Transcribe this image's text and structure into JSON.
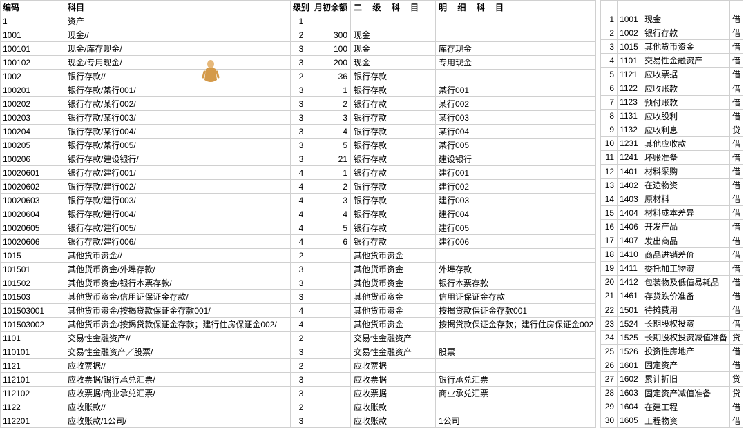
{
  "left": {
    "headers": {
      "code": "编码",
      "subject": "科目",
      "level": "级别",
      "balance": "月初余额",
      "level2": "二 级 科 目",
      "detail": "明   细   科   目"
    },
    "rows": [
      {
        "code": "1",
        "subject": "资产",
        "level": "1",
        "balance": "",
        "l2": "",
        "detail": ""
      },
      {
        "code": "1001",
        "subject": "现金//",
        "level": "2",
        "balance": "300",
        "l2": "现金",
        "detail": ""
      },
      {
        "code": "100101",
        "subject": "现金/库存现金/",
        "level": "3",
        "balance": "100",
        "l2": "现金",
        "detail": "库存现金"
      },
      {
        "code": "100102",
        "subject": "现金/专用现金/",
        "level": "3",
        "balance": "200",
        "l2": "现金",
        "detail": "专用现金"
      },
      {
        "code": "1002",
        "subject": "银行存款//",
        "level": "2",
        "balance": "36",
        "l2": "银行存款",
        "detail": ""
      },
      {
        "code": "100201",
        "subject": "银行存款/某行001/",
        "level": "3",
        "balance": "1",
        "l2": "银行存款",
        "detail": "某行001"
      },
      {
        "code": "100202",
        "subject": "银行存款/某行002/",
        "level": "3",
        "balance": "2",
        "l2": "银行存款",
        "detail": "某行002"
      },
      {
        "code": "100203",
        "subject": "银行存款/某行003/",
        "level": "3",
        "balance": "3",
        "l2": "银行存款",
        "detail": "某行003"
      },
      {
        "code": "100204",
        "subject": "银行存款/某行004/",
        "level": "3",
        "balance": "4",
        "l2": "银行存款",
        "detail": "某行004"
      },
      {
        "code": "100205",
        "subject": "银行存款/某行005/",
        "level": "3",
        "balance": "5",
        "l2": "银行存款",
        "detail": "某行005"
      },
      {
        "code": "100206",
        "subject": "银行存款/建设银行/",
        "level": "3",
        "balance": "21",
        "l2": "银行存款",
        "detail": "建设银行"
      },
      {
        "code": "10020601",
        "subject": "银行存款/建行001/",
        "level": "4",
        "balance": "1",
        "l2": "银行存款",
        "detail": "建行001"
      },
      {
        "code": "10020602",
        "subject": "银行存款/建行002/",
        "level": "4",
        "balance": "2",
        "l2": "银行存款",
        "detail": "建行002"
      },
      {
        "code": "10020603",
        "subject": "银行存款/建行003/",
        "level": "4",
        "balance": "3",
        "l2": "银行存款",
        "detail": "建行003"
      },
      {
        "code": "10020604",
        "subject": "银行存款/建行004/",
        "level": "4",
        "balance": "4",
        "l2": "银行存款",
        "detail": "建行004"
      },
      {
        "code": "10020605",
        "subject": "银行存款/建行005/",
        "level": "4",
        "balance": "5",
        "l2": "银行存款",
        "detail": "建行005"
      },
      {
        "code": "10020606",
        "subject": "银行存款/建行006/",
        "level": "4",
        "balance": "6",
        "l2": "银行存款",
        "detail": "建行006"
      },
      {
        "code": "1015",
        "subject": "其他货币资金//",
        "level": "2",
        "balance": "",
        "l2": "其他货币资金",
        "detail": ""
      },
      {
        "code": "101501",
        "subject": "其他货币资金/外埠存款/",
        "level": "3",
        "balance": "",
        "l2": "其他货币资金",
        "detail": "外埠存款"
      },
      {
        "code": "101502",
        "subject": "其他货币资金/银行本票存款/",
        "level": "3",
        "balance": "",
        "l2": "其他货币资金",
        "detail": "银行本票存款"
      },
      {
        "code": "101503",
        "subject": "其他货币资金/信用证保证金存款/",
        "level": "3",
        "balance": "",
        "l2": "其他货币资金",
        "detail": "信用证保证金存款"
      },
      {
        "code": "101503001",
        "subject": "其他货币资金/按揭贷款保证金存款001/",
        "level": "4",
        "balance": "",
        "l2": "其他货币资金",
        "detail": "按揭贷款保证金存款001"
      },
      {
        "code": "101503002",
        "subject": "其他货币资金/按揭贷款保证金存款；建行住房保证金002/",
        "level": "4",
        "balance": "",
        "l2": "其他货币资金",
        "detail": "按揭贷款保证金存款；建行住房保证金002"
      },
      {
        "code": "1101",
        "subject": "交易性金融资产//",
        "level": "2",
        "balance": "",
        "l2": "交易性金融资产",
        "detail": ""
      },
      {
        "code": "110101",
        "subject": "交易性金融资产／股票/",
        "level": "3",
        "balance": "",
        "l2": "交易性金融资产",
        "detail": "股票"
      },
      {
        "code": "1121",
        "subject": "应收票据//",
        "level": "2",
        "balance": "",
        "l2": "应收票据",
        "detail": ""
      },
      {
        "code": "112101",
        "subject": "应收票据/银行承兑汇票/",
        "level": "3",
        "balance": "",
        "l2": "应收票据",
        "detail": "银行承兑汇票"
      },
      {
        "code": "112102",
        "subject": "应收票据/商业承兑汇票/",
        "level": "3",
        "balance": "",
        "l2": "应收票据",
        "detail": "商业承兑汇票"
      },
      {
        "code": "1122",
        "subject": "应收账款//",
        "level": "2",
        "balance": "",
        "l2": "应收账款",
        "detail": ""
      },
      {
        "code": "112201",
        "subject": "应收账款/1公司/",
        "level": "3",
        "balance": "",
        "l2": "应收账款",
        "detail": "1公司"
      }
    ]
  },
  "right": {
    "rows": [
      {
        "n": "1",
        "ac": "1001",
        "nm": "现金",
        "dc": "借"
      },
      {
        "n": "2",
        "ac": "1002",
        "nm": "银行存款",
        "dc": "借"
      },
      {
        "n": "3",
        "ac": "1015",
        "nm": "其他货币资金",
        "dc": "借"
      },
      {
        "n": "4",
        "ac": "1101",
        "nm": "交易性金融资产",
        "dc": "借"
      },
      {
        "n": "5",
        "ac": "1121",
        "nm": "应收票据",
        "dc": "借"
      },
      {
        "n": "6",
        "ac": "1122",
        "nm": "应收账款",
        "dc": "借"
      },
      {
        "n": "7",
        "ac": "1123",
        "nm": "预付账款",
        "dc": "借"
      },
      {
        "n": "8",
        "ac": "1131",
        "nm": "应收股利",
        "dc": "借"
      },
      {
        "n": "9",
        "ac": "1132",
        "nm": "应收利息",
        "dc": "贷"
      },
      {
        "n": "10",
        "ac": "1231",
        "nm": "其他应收款",
        "dc": "借"
      },
      {
        "n": "11",
        "ac": "1241",
        "nm": "坏账准备",
        "dc": "借"
      },
      {
        "n": "12",
        "ac": "1401",
        "nm": "材料采购",
        "dc": "借"
      },
      {
        "n": "13",
        "ac": "1402",
        "nm": "在途物资",
        "dc": "借"
      },
      {
        "n": "14",
        "ac": "1403",
        "nm": "原材料",
        "dc": "借"
      },
      {
        "n": "15",
        "ac": "1404",
        "nm": "材料成本差异",
        "dc": "借"
      },
      {
        "n": "16",
        "ac": "1406",
        "nm": "开发产品",
        "dc": "借"
      },
      {
        "n": "17",
        "ac": "1407",
        "nm": "发出商品",
        "dc": "借"
      },
      {
        "n": "18",
        "ac": "1410",
        "nm": "商品进销差价",
        "dc": "借"
      },
      {
        "n": "19",
        "ac": "1411",
        "nm": "委托加工物资",
        "dc": "借"
      },
      {
        "n": "20",
        "ac": "1412",
        "nm": "包装物及低值易耗品",
        "dc": "借"
      },
      {
        "n": "21",
        "ac": "1461",
        "nm": "存货跌价准备",
        "dc": "借"
      },
      {
        "n": "22",
        "ac": "1501",
        "nm": "待摊费用",
        "dc": "借"
      },
      {
        "n": "23",
        "ac": "1524",
        "nm": "长期股权投资",
        "dc": "借"
      },
      {
        "n": "24",
        "ac": "1525",
        "nm": "长期股权投资减值准备",
        "dc": "贷"
      },
      {
        "n": "25",
        "ac": "1526",
        "nm": "投资性房地产",
        "dc": "借"
      },
      {
        "n": "26",
        "ac": "1601",
        "nm": "固定资产",
        "dc": "借"
      },
      {
        "n": "27",
        "ac": "1602",
        "nm": "累计折旧",
        "dc": "贷"
      },
      {
        "n": "28",
        "ac": "1603",
        "nm": "固定资产减值准备",
        "dc": "贷"
      },
      {
        "n": "29",
        "ac": "1604",
        "nm": "在建工程",
        "dc": "借"
      },
      {
        "n": "30",
        "ac": "1605",
        "nm": "工程物资",
        "dc": "借"
      }
    ]
  }
}
